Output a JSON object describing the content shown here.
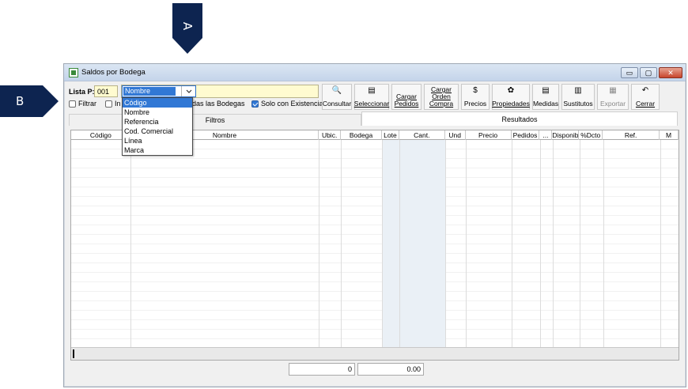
{
  "markers": {
    "a": "A",
    "b": "B"
  },
  "colors": {
    "marker": "#0d2450",
    "selection": "#3178d5",
    "highlight_field": "#fffbd0"
  },
  "window": {
    "title": "Saldos por Bodega",
    "buttons": {
      "minimize": "▭",
      "maximize": "▢",
      "close": "✕"
    }
  },
  "form": {
    "lista_label": "Lista P:",
    "lista_value": "001",
    "search_by": {
      "selected": "Nombre",
      "options": [
        "Código",
        "Nombre",
        "Referencia",
        "Cod. Comercial",
        "Línea",
        "Marca"
      ],
      "highlighted": "Código"
    },
    "checkboxes": [
      {
        "label": "Filtrar",
        "checked": false
      },
      {
        "label": "In",
        "checked": false
      },
      {
        "label": "das las Bodegas",
        "checked": false
      },
      {
        "label": "Solo con Existencia",
        "checked": true
      }
    ]
  },
  "toolbar": [
    {
      "label": "Consultar",
      "icon": "magnifier-icon",
      "glyph": "🔍"
    },
    {
      "label": "Seleccionar",
      "icon": "select-icon",
      "glyph": "▤"
    },
    {
      "label": "Cargar Pedidos",
      "icon": "",
      "glyph": ""
    },
    {
      "label": "Cargar Orden Compra",
      "icon": "",
      "glyph": ""
    },
    {
      "label": "Precios",
      "icon": "price-icon",
      "glyph": "$"
    },
    {
      "label": "Propiedades",
      "icon": "properties-icon",
      "glyph": "✿"
    },
    {
      "label": "Medidas",
      "icon": "measures-icon",
      "glyph": "▤"
    },
    {
      "label": "Sustitutos",
      "icon": "substitutes-icon",
      "glyph": "▥"
    },
    {
      "label": "Exportar",
      "icon": "export-icon",
      "glyph": "▦",
      "disabled": true
    },
    {
      "label": "Cerrar",
      "icon": "undo-icon",
      "glyph": "↶"
    }
  ],
  "tabs": {
    "filtros": "Filtros",
    "resultados": "Resultados"
  },
  "grid": {
    "columns": [
      "Código",
      "Nombre",
      "Ubic.",
      "Bodega",
      "Lote",
      "Cant.",
      "Und",
      "Precio",
      "Pedidos",
      "...",
      "Disponibl",
      "%Dcto",
      "Ref.",
      "M"
    ]
  },
  "totals": {
    "cantidad": "0",
    "valor": "0.00"
  }
}
